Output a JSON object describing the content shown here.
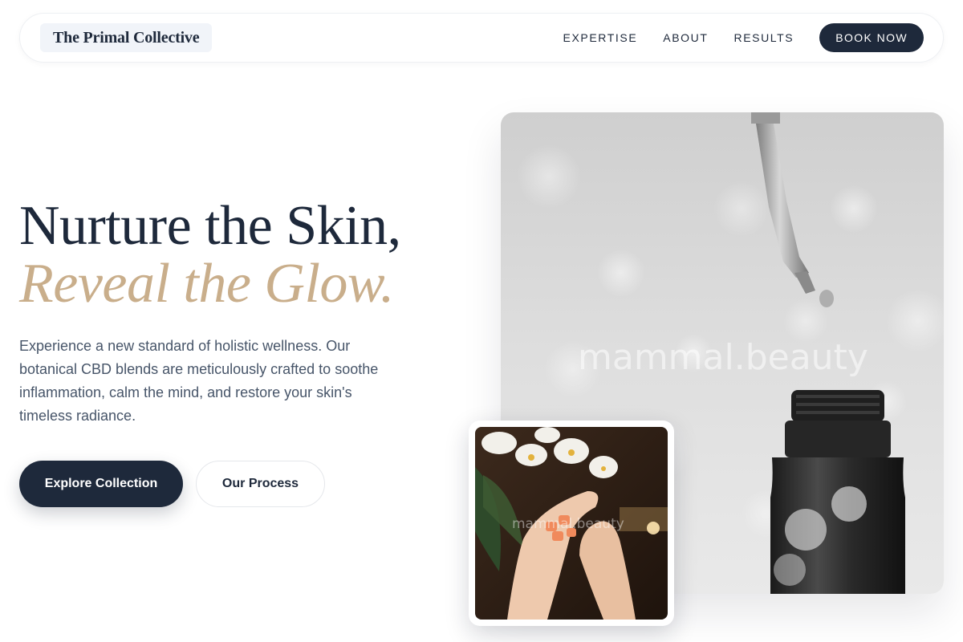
{
  "header": {
    "brand": "The Primal Collective",
    "nav": [
      "EXPERTISE",
      "ABOUT",
      "RESULTS"
    ],
    "cta": "BOOK NOW"
  },
  "hero": {
    "title_line1": "Nurture the Skin,",
    "title_line2": "Reveal the Glow.",
    "description": "Experience a new standard of holistic wellness. Our botanical CBD blends are meticulously crafted to soothe inflammation, calm the mind, and restore your skin's timeless radiance.",
    "primary_button": "Explore Collection",
    "secondary_button": "Our Process"
  },
  "images": {
    "main_watermark": "mammal.beauty",
    "thumb_watermark": "mammal.beauty"
  },
  "colors": {
    "navy": "#1e293b",
    "gold_accent": "#c9ae8b",
    "body_text": "#475569",
    "brand_bg": "#f1f4f9"
  }
}
